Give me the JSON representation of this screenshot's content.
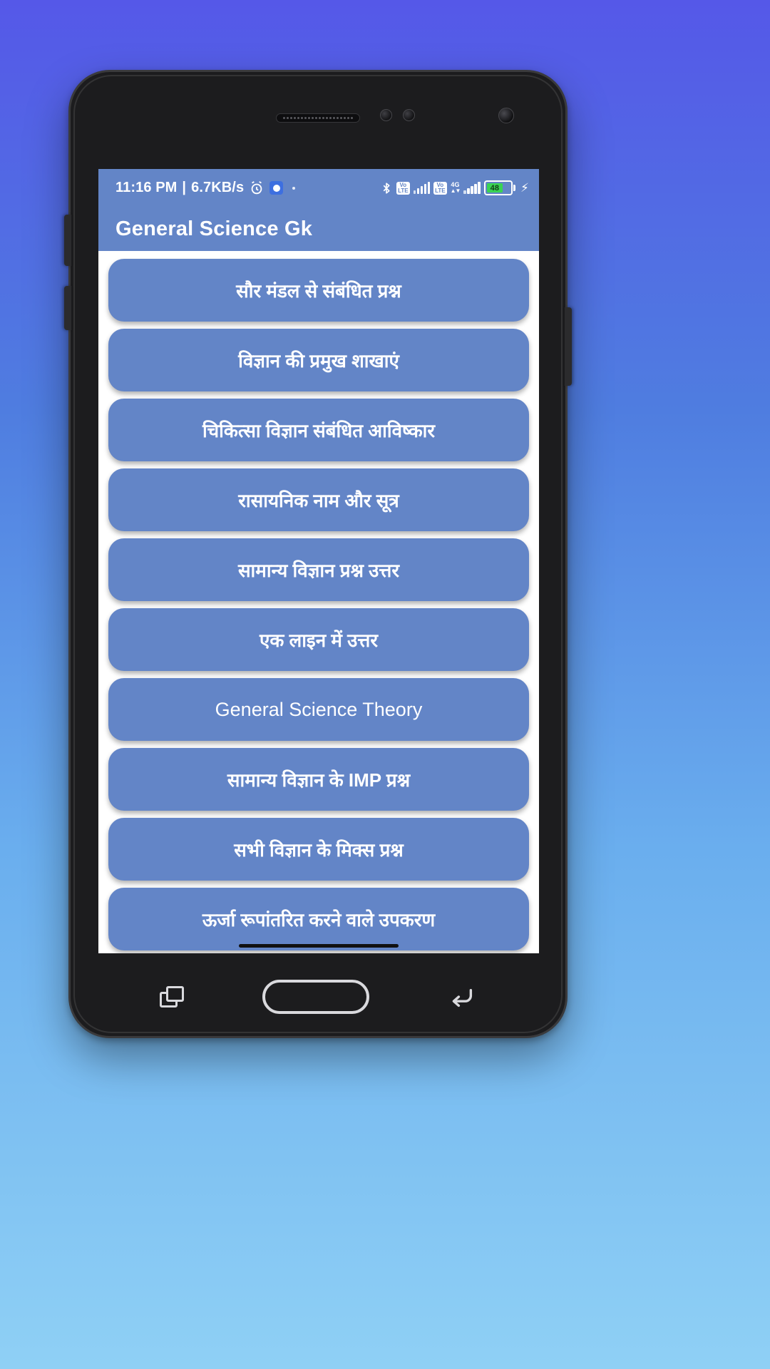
{
  "wallpaper": {
    "gradient_top": "#5558e8",
    "gradient_bottom": "#8fd0f5"
  },
  "device": {
    "name": "android-phone-mockup",
    "body_color": "#1c1c1e"
  },
  "theme": {
    "accent": "#6385c7",
    "button_text": "#ffffff",
    "screen_background": "#ffffff",
    "battery_fill": "#39d353"
  },
  "statusbar": {
    "time": "11:16 PM",
    "separator": "|",
    "network_speed": "6.7KB/s",
    "alarm_icon": "alarm-clock-icon",
    "app_badge_icon": "app-notification-icon",
    "extra_dot": "·",
    "bluetooth_icon": "bluetooth-icon",
    "volte_label_1": "VoLTE",
    "volte_label_2": "VoLTE",
    "signal_icon_1": "signal-bars-icon",
    "signal_icon_2": "signal-bars-icon",
    "network_type": "4G",
    "data_arrows": "⇅",
    "battery_percent": "48",
    "charging_icon": "⚡"
  },
  "appbar": {
    "title": "General Science Gk"
  },
  "list": {
    "items": [
      {
        "label": "सौर मंडल से संबंधित प्रश्न",
        "script": "devanagari"
      },
      {
        "label": "विज्ञान की प्रमुख शाखाएं",
        "script": "devanagari"
      },
      {
        "label": "चिकित्सा विज्ञान संबंधित आविष्कार",
        "script": "devanagari"
      },
      {
        "label": "रासायनिक नाम और सूत्र",
        "script": "devanagari"
      },
      {
        "label": "सामान्य विज्ञान प्रश्न उत्तर",
        "script": "devanagari"
      },
      {
        "label": "एक लाइन में उत्तर",
        "script": "devanagari"
      },
      {
        "label": "General Science Theory",
        "script": "latin"
      },
      {
        "label": "सामान्य विज्ञान के IMP प्रश्न",
        "script": "devanagari"
      },
      {
        "label": "सभी विज्ञान के मिक्स प्रश्न",
        "script": "devanagari"
      },
      {
        "label": "ऊर्जा रूपांतरित करने वाले उपकरण",
        "script": "devanagari"
      }
    ]
  },
  "navbar": {
    "recent_icon": "recent-apps-icon",
    "home_icon": "home-pill-icon",
    "back_icon": "back-arrow-icon"
  }
}
